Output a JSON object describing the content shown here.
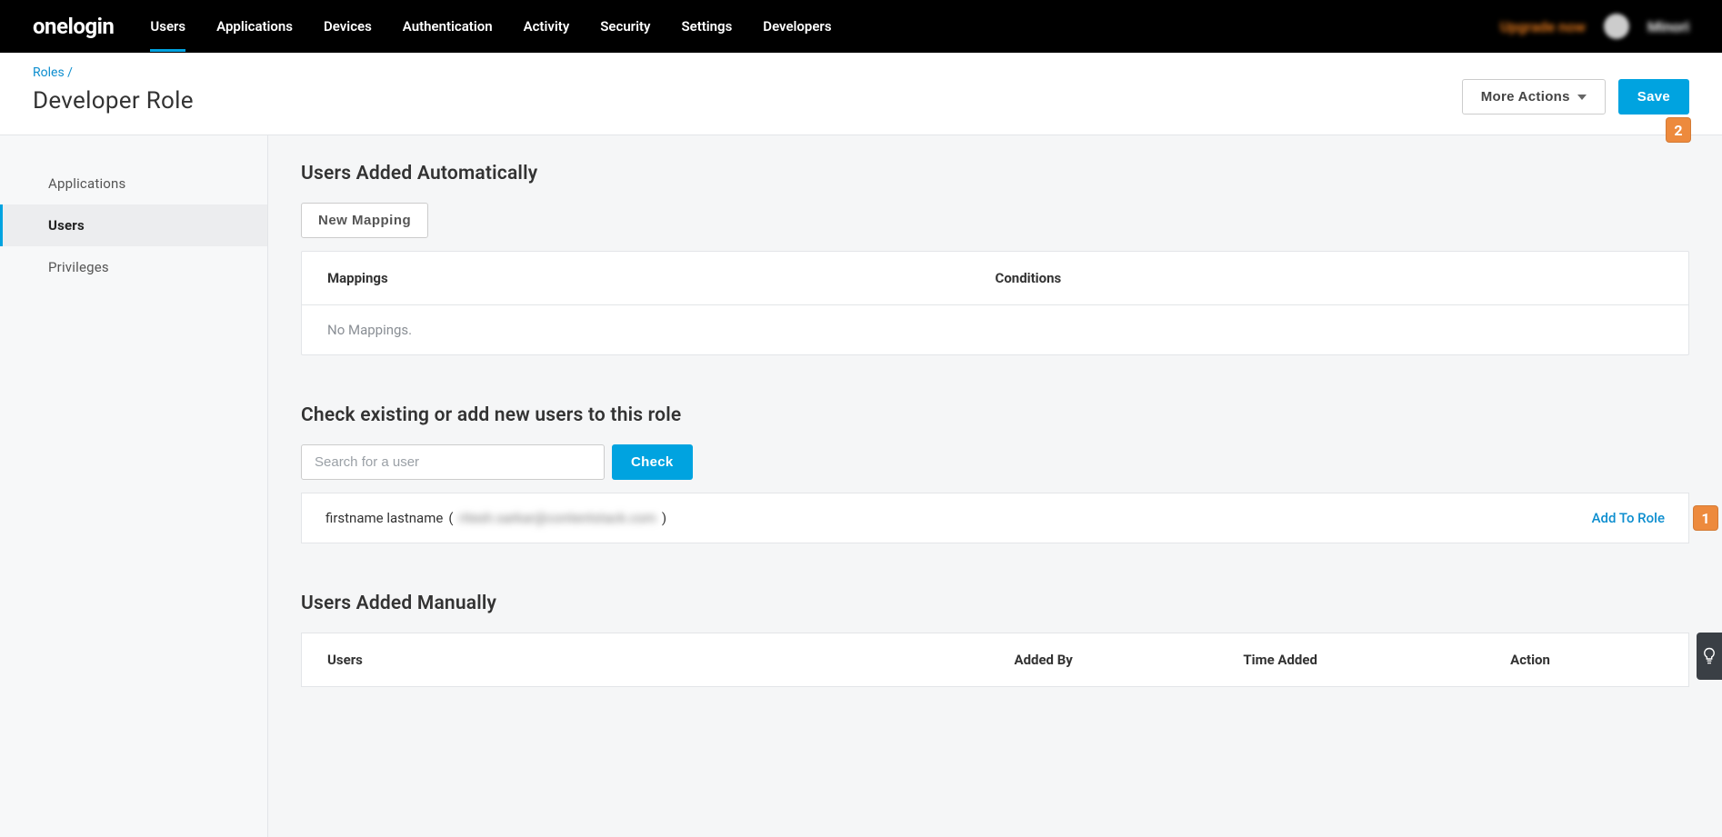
{
  "logo": "onelogin",
  "nav": {
    "items": [
      "Users",
      "Applications",
      "Devices",
      "Authentication",
      "Activity",
      "Security",
      "Settings",
      "Developers"
    ],
    "active_index": 0,
    "upgrade": "Upgrade now",
    "username": "Minori"
  },
  "subheader": {
    "breadcrumb_parent": "Roles",
    "breadcrumb_sep": " / ",
    "title": "Developer Role",
    "more_actions": "More Actions",
    "save": "Save"
  },
  "sidebar": {
    "items": [
      "Applications",
      "Users",
      "Privileges"
    ],
    "active_index": 1
  },
  "auto_section": {
    "title": "Users Added Automatically",
    "new_mapping": "New Mapping",
    "col_mappings": "Mappings",
    "col_conditions": "Conditions",
    "empty": "No Mappings."
  },
  "check_section": {
    "title": "Check existing or add new users to this role",
    "placeholder": "Search for a user",
    "check_btn": "Check",
    "result_name": "firstname lastname",
    "result_open": " ( ",
    "result_email": "ritesh.sarkar@contentstack.com",
    "result_close": " )",
    "add_to_role": "Add To Role"
  },
  "manual_section": {
    "title": "Users Added Manually",
    "col_users": "Users",
    "col_added_by": "Added By",
    "col_time": "Time Added",
    "col_action": "Action"
  },
  "callouts": {
    "one": "1",
    "two": "2"
  },
  "help_icon": "lightbulb-icon"
}
